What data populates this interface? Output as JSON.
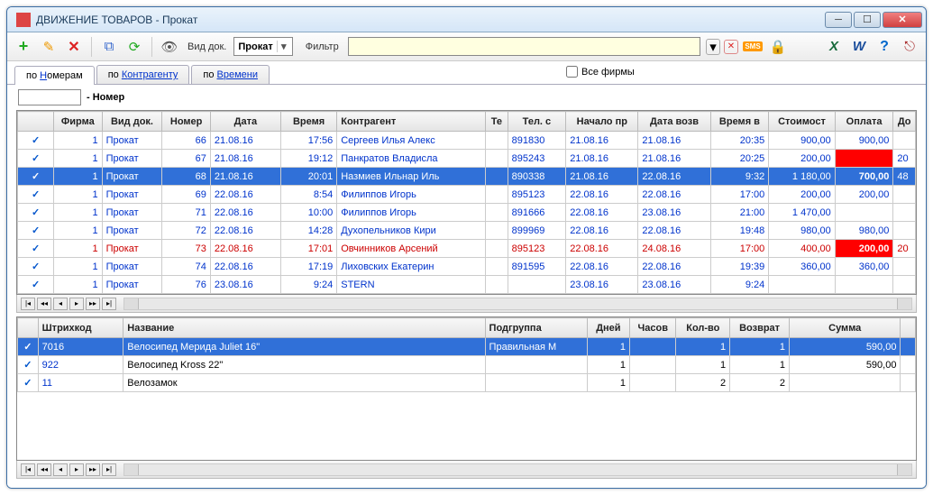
{
  "window": {
    "title": "ДВИЖЕНИЕ ТОВАРОВ - Прокат"
  },
  "toolbar": {
    "doc_label": "Вид док.",
    "doc_value": "Прокат",
    "filter_label": "Фильтр",
    "all_firms": "Все фирмы"
  },
  "tabs": {
    "by_numbers_prefix": "по ",
    "by_numbers_u": "Н",
    "by_numbers_suffix": "омерам",
    "by_agent_prefix": "по ",
    "by_agent_u": "К",
    "by_agent_suffix": "онтрагенту",
    "by_time_prefix": "по ",
    "by_time_u": "В",
    "by_time_suffix": "ремени"
  },
  "search": {
    "label": "- Номер"
  },
  "grid1": {
    "headers": {
      "firm": "Фирма",
      "doc": "Вид док.",
      "num": "Номер",
      "date": "Дата",
      "time": "Время",
      "agent": "Контрагент",
      "ph1": "Те",
      "ph2": "Тел. с",
      "start": "Начало пр",
      "ret": "Дата возв",
      "rtime": "Время в",
      "cost": "Стоимост",
      "pay": "Оплата",
      "last": "До"
    },
    "rows": [
      {
        "firm": "1",
        "doc": "Прокат",
        "num": "66",
        "date": "21.08.16",
        "time": "17:56",
        "agent": "Сергеев Илья Алекс",
        "ph": "891830",
        "start": "21.08.16",
        "ret": "21.08.16",
        "rtime": "20:35",
        "cost": "900,00",
        "pay": "900,00"
      },
      {
        "firm": "1",
        "doc": "Прокат",
        "num": "67",
        "date": "21.08.16",
        "time": "19:12",
        "agent": "Панкратов Владисла",
        "ph": "895243",
        "start": "21.08.16",
        "ret": "21.08.16",
        "rtime": "20:25",
        "cost": "200,00",
        "pay": "",
        "payred": true,
        "last": "20"
      },
      {
        "sel": true,
        "firm": "1",
        "doc": "Прокат",
        "num": "68",
        "date": "21.08.16",
        "time": "20:01",
        "agent": "Назмиев Ильнар Иль",
        "ph": "890338",
        "start": "21.08.16",
        "ret": "22.08.16",
        "rtime": "9:32",
        "cost": "1 180,00",
        "pay": "700,00",
        "payyellow": true,
        "last": "48"
      },
      {
        "firm": "1",
        "doc": "Прокат",
        "num": "69",
        "date": "22.08.16",
        "time": "8:54",
        "agent": "Филиппов Игорь",
        "ph": "895123",
        "start": "22.08.16",
        "ret": "22.08.16",
        "rtime": "17:00",
        "cost": "200,00",
        "pay": "200,00"
      },
      {
        "firm": "1",
        "doc": "Прокат",
        "num": "71",
        "date": "22.08.16",
        "time": "10:00",
        "agent": "Филиппов Игорь",
        "ph": "891666",
        "start": "22.08.16",
        "ret": "23.08.16",
        "rtime": "21:00",
        "cost": "1 470,00",
        "pay": ""
      },
      {
        "firm": "1",
        "doc": "Прокат",
        "num": "72",
        "date": "22.08.16",
        "time": "14:28",
        "agent": "Духопельников Кири",
        "ph": "899969",
        "start": "22.08.16",
        "ret": "22.08.16",
        "rtime": "19:48",
        "cost": "980,00",
        "pay": "980,00"
      },
      {
        "red": true,
        "firm": "1",
        "doc": "Прокат",
        "num": "73",
        "date": "22.08.16",
        "time": "17:01",
        "agent": "Овчинников Арсений",
        "ph": "895123",
        "start": "22.08.16",
        "ret": "24.08.16",
        "rtime": "17:00",
        "cost": "400,00",
        "pay": "200,00",
        "payred2": true,
        "last": "20"
      },
      {
        "firm": "1",
        "doc": "Прокат",
        "num": "74",
        "date": "22.08.16",
        "time": "17:19",
        "agent": "Лиховских Екатерин",
        "ph": "891595",
        "start": "22.08.16",
        "ret": "22.08.16",
        "rtime": "19:39",
        "cost": "360,00",
        "pay": "360,00"
      },
      {
        "firm": "1",
        "doc": "Прокат",
        "num": "76",
        "date": "23.08.16",
        "time": "9:24",
        "agent": "STERN",
        "ph": "",
        "start": "23.08.16",
        "ret": "23.08.16",
        "rtime": "9:24",
        "cost": "",
        "pay": ""
      }
    ]
  },
  "grid2": {
    "headers": {
      "code": "Штрихкод",
      "name": "Название",
      "sub": "Подгруппа",
      "days": "Дней",
      "hours": "Часов",
      "qty": "Кол-во",
      "ret": "Возврат",
      "sum": "Сумма"
    },
    "rows": [
      {
        "sel": true,
        "code": "7016",
        "name": "Велосипед Мерида Juliet 16\"",
        "sub": "Правильная М",
        "days": "1",
        "hours": "",
        "qty": "1",
        "ret": "1",
        "sum": "590,00"
      },
      {
        "code": "922",
        "name": "Велосипед Kross 22\"",
        "sub": "",
        "days": "1",
        "hours": "",
        "qty": "1",
        "ret": "1",
        "sum": "590,00"
      },
      {
        "code": "11",
        "name": "Велозамок",
        "sub": "",
        "days": "1",
        "hours": "",
        "qty": "2",
        "ret": "2",
        "sum": ""
      }
    ]
  }
}
